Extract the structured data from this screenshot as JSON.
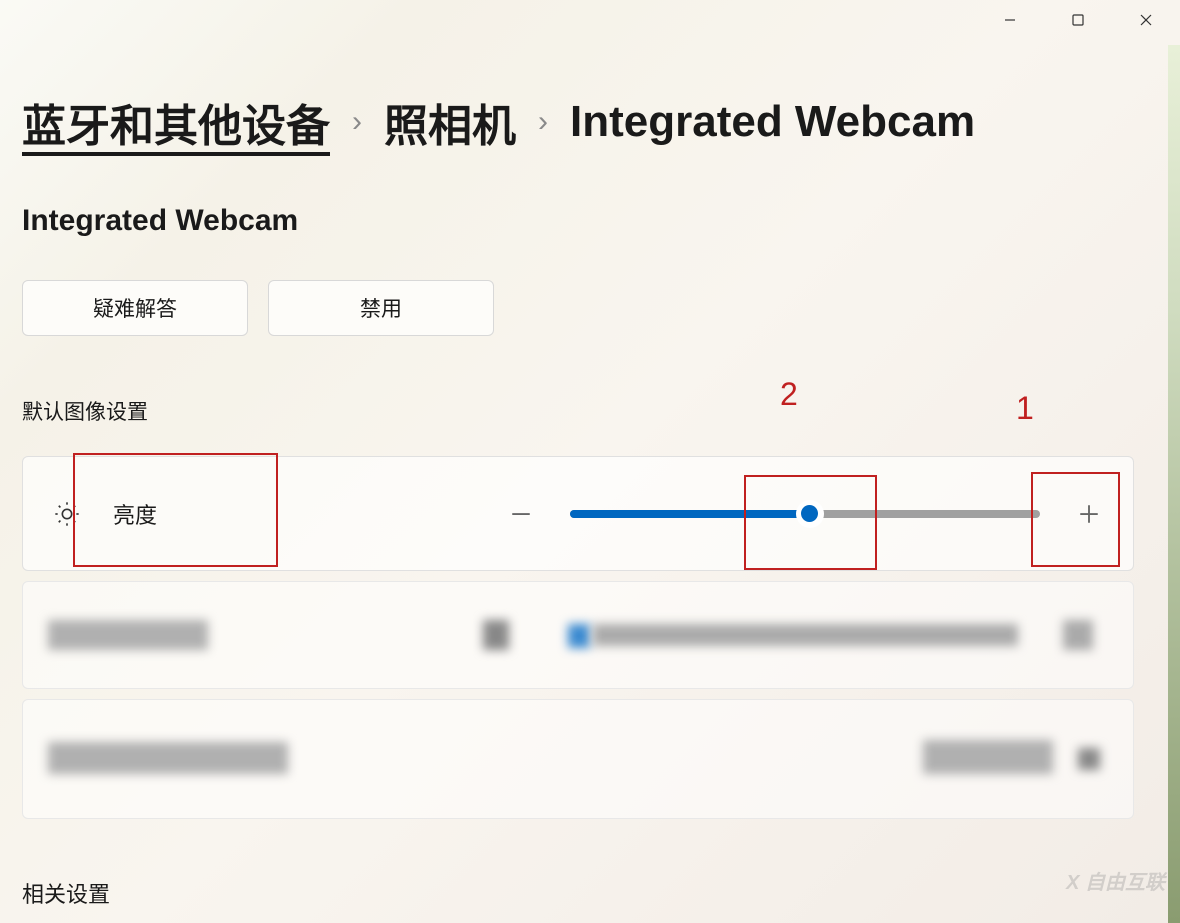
{
  "titlebar": {
    "minimize": "−",
    "maximize": "□",
    "close": "×"
  },
  "breadcrumb": {
    "level1": "蓝牙和其他设备",
    "level2": "照相机",
    "level3": "Integrated Webcam"
  },
  "subtitle": "Integrated Webcam",
  "buttons": {
    "troubleshoot": "疑难解答",
    "disable": "禁用"
  },
  "sections": {
    "default_image_settings": "默认图像设置",
    "related_settings": "相关设置"
  },
  "brightness": {
    "label": "亮度",
    "value_percent": 50,
    "icon": "brightness-icon"
  },
  "annotations": {
    "one": "1",
    "two": "2"
  },
  "watermark": "自由互联",
  "colors": {
    "accent": "#0067c0",
    "highlight_border": "#c02020"
  }
}
